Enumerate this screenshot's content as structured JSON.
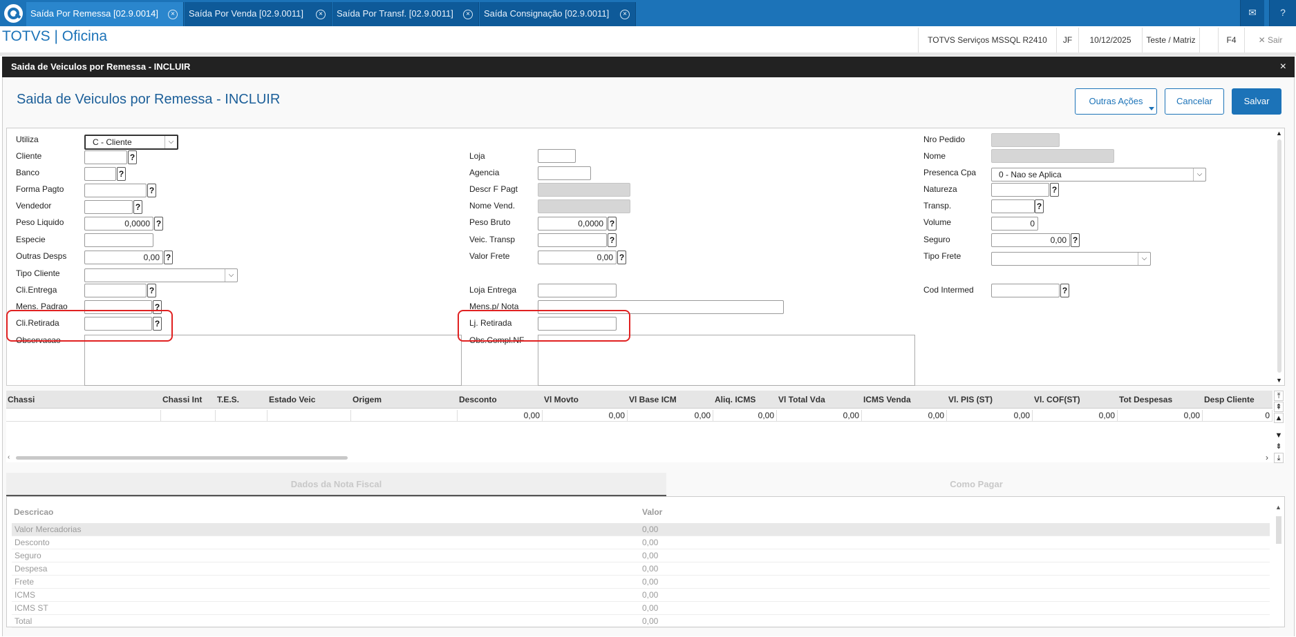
{
  "tabs": [
    {
      "label": "Saída Por Remessa [02.9.0014]",
      "active": true
    },
    {
      "label": "Saída Por Venda [02.9.0011]",
      "active": false
    },
    {
      "label": "Saída Por Transf. [02.9.0011]",
      "active": false
    },
    {
      "label": "Saída Consignação [02.9.0011]",
      "active": false
    }
  ],
  "app": {
    "title": "TOTVS | Oficina",
    "env": "TOTVS Serviços MSSQL R2410",
    "user": "JF",
    "date": "10/12/2025",
    "company": "Teste / Matriz",
    "shortcut": "F4",
    "exit": "Sair"
  },
  "dialog": {
    "title": "Saida de Veiculos por Remessa - INCLUIR",
    "close": "×",
    "form_title": "Saida de Veiculos por Remessa - INCLUIR",
    "buttons": {
      "more": "Outras Ações",
      "cancel": "Cancelar",
      "save": "Salvar"
    }
  },
  "form": {
    "utiliza": {
      "label": "Utiliza",
      "value": "C - Cliente"
    },
    "cliente": {
      "label": "Cliente",
      "value": ""
    },
    "banco": {
      "label": "Banco",
      "value": ""
    },
    "forma_pagto": {
      "label": "Forma Pagto",
      "value": ""
    },
    "vendedor": {
      "label": "Vendedor",
      "value": ""
    },
    "peso_liquido": {
      "label": "Peso Liquido",
      "value": "0,0000"
    },
    "especie": {
      "label": "Especie",
      "value": ""
    },
    "outras_desps": {
      "label": "Outras Desps",
      "value": "0,00"
    },
    "tipo_cliente": {
      "label": "Tipo Cliente",
      "value": ""
    },
    "cli_entrega": {
      "label": "Cli.Entrega",
      "value": ""
    },
    "mens_padrao": {
      "label": "Mens. Padrao",
      "value": ""
    },
    "cli_retirada": {
      "label": "Cli.Retirada",
      "value": ""
    },
    "observacao": {
      "label": "Observacao",
      "value": ""
    },
    "loja": {
      "label": "Loja",
      "value": ""
    },
    "agencia": {
      "label": "Agencia",
      "value": ""
    },
    "descr_f_pagt": {
      "label": "Descr F Pagt",
      "value": ""
    },
    "nome_vend": {
      "label": "Nome Vend.",
      "value": ""
    },
    "peso_bruto": {
      "label": "Peso Bruto",
      "value": "0,0000"
    },
    "veic_transp": {
      "label": "Veic. Transp",
      "value": ""
    },
    "valor_frete": {
      "label": "Valor Frete",
      "value": "0,00"
    },
    "loja_entrega": {
      "label": "Loja Entrega",
      "value": ""
    },
    "mens_p_nota": {
      "label": "Mens.p/ Nota",
      "value": ""
    },
    "lj_retirada": {
      "label": "Lj. Retirada",
      "value": ""
    },
    "obs_compl_nf": {
      "label": "Obs.Compl.NF",
      "value": ""
    },
    "nro_pedido": {
      "label": "Nro Pedido",
      "value": ""
    },
    "nome": {
      "label": "Nome",
      "value": ""
    },
    "presenca_cpa": {
      "label": "Presenca Cpa",
      "value": "0 - Nao se Aplica"
    },
    "natureza": {
      "label": "Natureza",
      "value": ""
    },
    "transp": {
      "label": "Transp.",
      "value": ""
    },
    "volume": {
      "label": "Volume",
      "value": "0"
    },
    "seguro": {
      "label": "Seguro",
      "value": "0,00"
    },
    "tipo_frete": {
      "label": "Tipo Frete",
      "value": ""
    },
    "cod_intermed": {
      "label": "Cod Intermed",
      "value": ""
    },
    "help": "?"
  },
  "grid": {
    "columns": [
      "Chassi",
      "Chassi Int",
      "T.E.S.",
      "Estado Veic",
      "Origem",
      "Desconto",
      "Vl Movto",
      "Vl Base ICM",
      "Aliq. ICMS",
      "Vl Total Vda",
      "ICMS Venda",
      "Vl. PIS (ST)",
      "Vl. COF(ST)",
      "Tot Despesas",
      "Desp Cliente"
    ],
    "row": [
      "",
      "",
      "",
      "",
      "",
      "0,00",
      "0,00",
      "0,00",
      "0,00",
      "0,00",
      "0,00",
      "0,00",
      "0,00",
      "0,00",
      "0"
    ]
  },
  "bottom_tabs": [
    "Dados da Nota Fiscal",
    "Como Pagar"
  ],
  "summary": {
    "head": {
      "desc": "Descricao",
      "value": "Valor"
    },
    "rows": [
      {
        "desc": "Valor Mercadorias",
        "value": "0,00"
      },
      {
        "desc": "Desconto",
        "value": "0,00"
      },
      {
        "desc": "Seguro",
        "value": "0,00"
      },
      {
        "desc": "Despesa",
        "value": "0,00"
      },
      {
        "desc": "Frete",
        "value": "0,00"
      },
      {
        "desc": "ICMS",
        "value": "0,00"
      },
      {
        "desc": "ICMS ST",
        "value": "0,00"
      },
      {
        "desc": "Total",
        "value": "0,00"
      }
    ]
  },
  "colors": {
    "brand": "#1c73b8",
    "highlight": "#e02020"
  }
}
